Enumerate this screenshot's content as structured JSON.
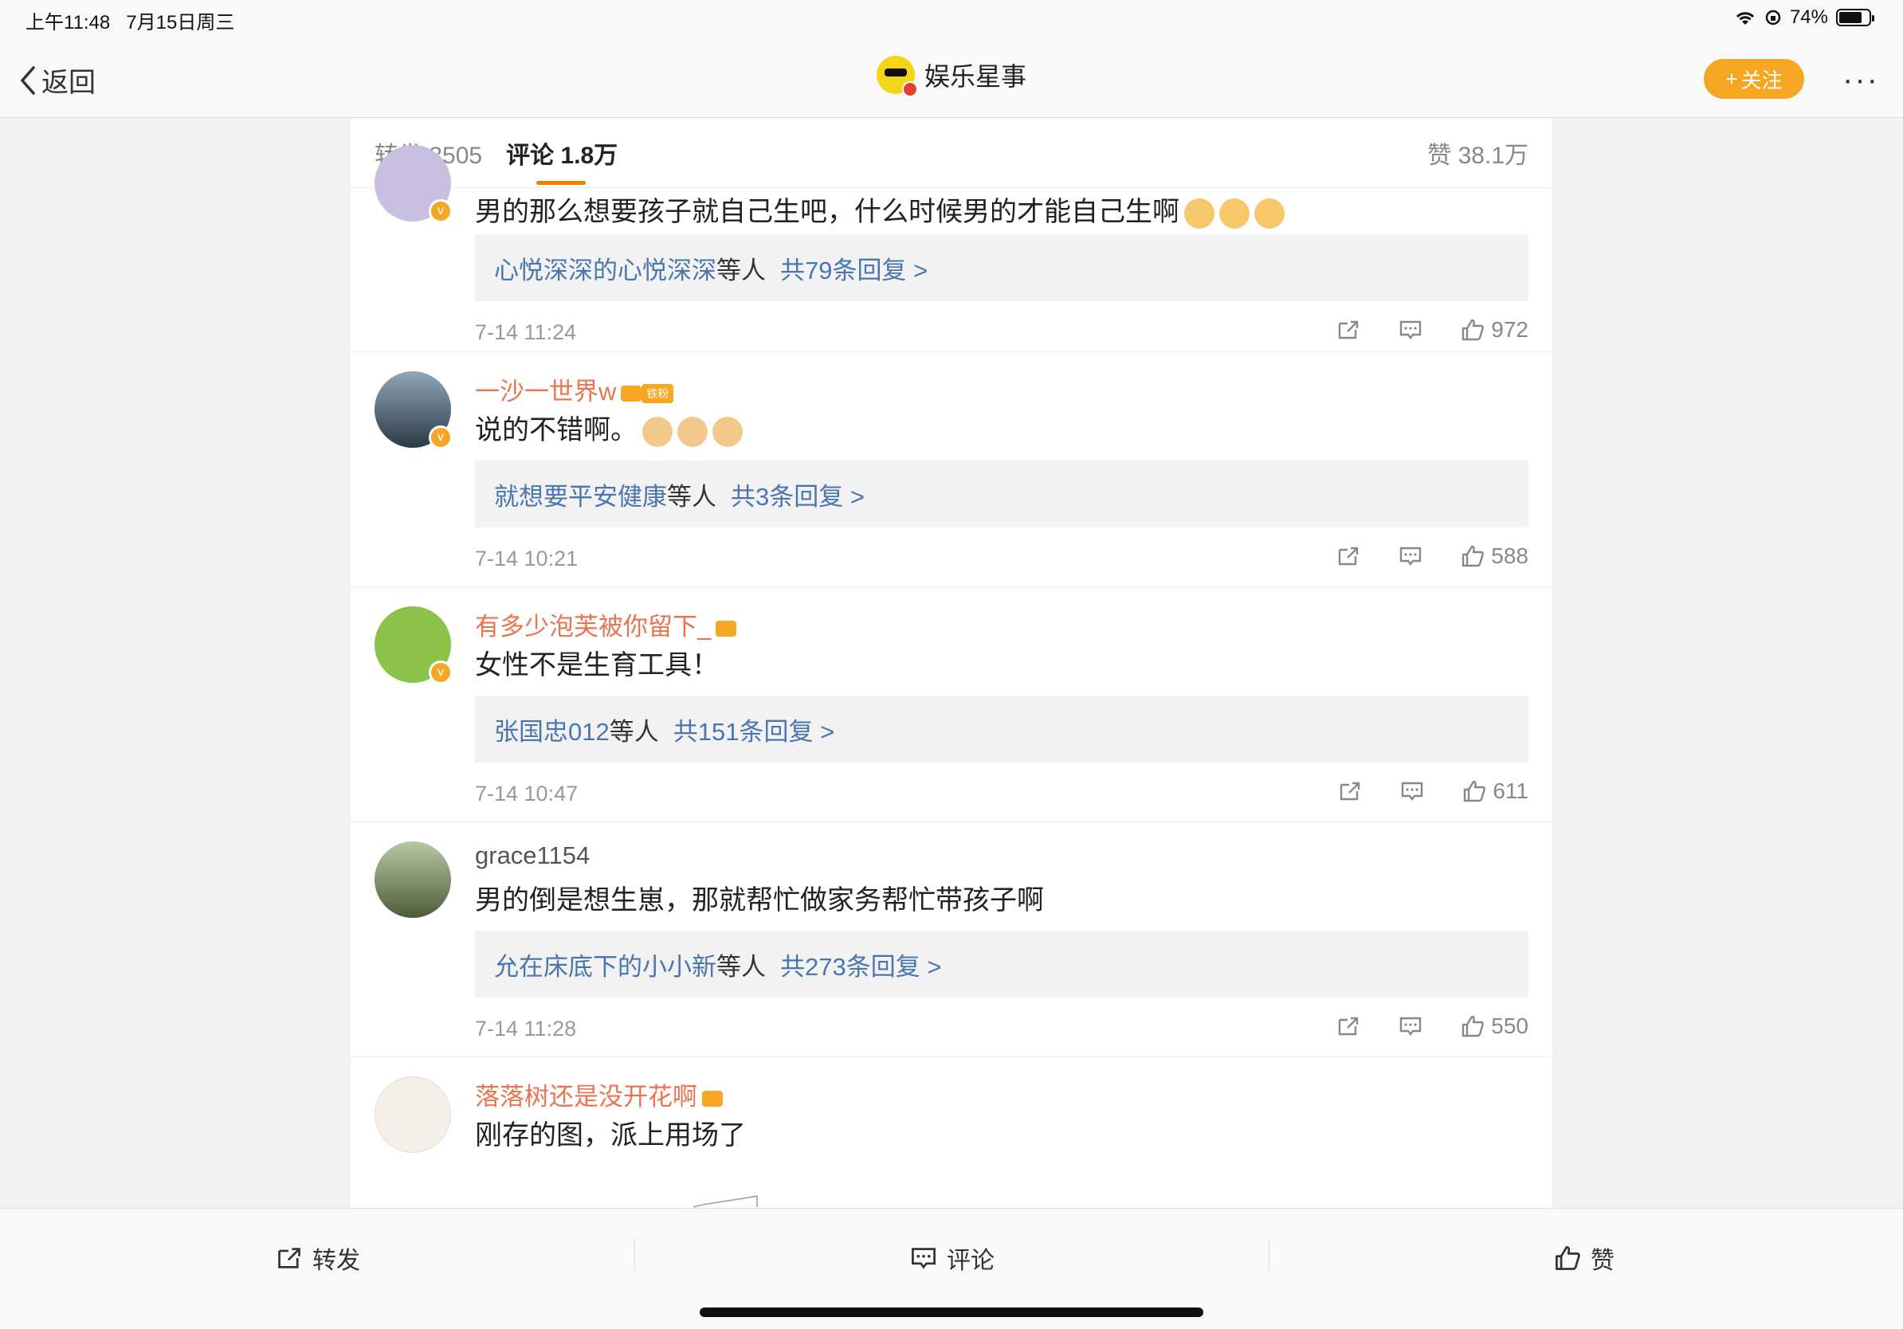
{
  "status_bar": {
    "time": "上午11:48",
    "date": "7月15日周三",
    "battery": "74%"
  },
  "nav": {
    "back_label": "返回",
    "account_name": "娱乐星事",
    "follow_label": "关注",
    "more_label": "···"
  },
  "tabs": {
    "repost_label": "转发",
    "repost_count": "3505",
    "comment_label": "评论",
    "comment_count": "1.8万",
    "like_label": "赞",
    "like_count": "38.1万"
  },
  "comments": [
    {
      "text": "男的那么想要孩子就自己生吧，什么时候男的才能自己生啊",
      "reply_names": "心悦深深的心悦深深",
      "reply_suffix": "等人",
      "reply_count": "共79条回复 >",
      "time": "7-14 11:24",
      "likes": "972"
    },
    {
      "username": "一沙一世界w",
      "badge": "铁粉",
      "text": "说的不错啊。",
      "reply_names": "就想要平安健康",
      "reply_suffix": "等人",
      "reply_count": "共3条回复 >",
      "time": "7-14 10:21",
      "likes": "588"
    },
    {
      "username": "有多少泡芙被你留下_",
      "text": "女性不是生育工具！",
      "reply_names": "张国忠012",
      "reply_suffix": "等人",
      "reply_count": "共151条回复 >",
      "time": "7-14 10:47",
      "likes": "611"
    },
    {
      "username": "grace1154",
      "text": "男的倒是想生崽，那就帮忙做家务帮忙带孩子啊",
      "reply_names": "允在床底下的小小新",
      "reply_suffix": "等人",
      "reply_count": "共273条回复 >",
      "time": "7-14 11:28",
      "likes": "550"
    },
    {
      "username": "落落树还是没开花啊",
      "text": "刚存的图，派上用场了"
    }
  ],
  "bottom_bar": {
    "repost": "转发",
    "comment": "评论",
    "like": "赞"
  },
  "colors": {
    "accent": "#f5a623",
    "link": "#4a76b0",
    "username": "#eb7350"
  }
}
